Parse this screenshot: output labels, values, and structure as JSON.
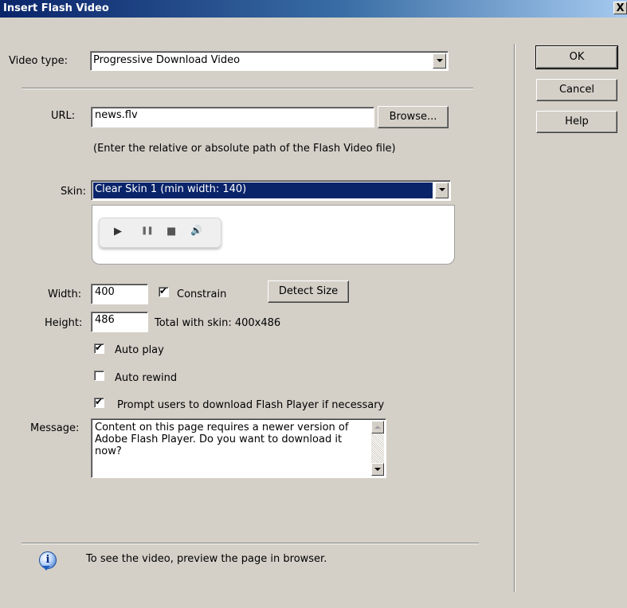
{
  "window": {
    "title": "Insert Flash Video",
    "close_label": "X"
  },
  "video_type": {
    "label": "Video type:",
    "value": "Progressive Download Video"
  },
  "url": {
    "label": "URL:",
    "value": "news.flv",
    "browse_label": "Browse...",
    "hint": "(Enter the relative or absolute path of the Flash Video file)"
  },
  "skin": {
    "label": "Skin:",
    "value": "Clear Skin 1 (min width: 140)",
    "preview_controls": {
      "play": "▶",
      "pause": "❚❚",
      "stop": "■",
      "volume": "🔊"
    }
  },
  "width": {
    "label": "Width:",
    "value": "400"
  },
  "constrain": {
    "label": "Constrain",
    "checked": true
  },
  "detect_size_label": "Detect Size",
  "height": {
    "label": "Height:",
    "value": "486"
  },
  "total_with_skin": "Total with skin: 400x486",
  "options": {
    "auto_play": {
      "label": "Auto play",
      "checked": true
    },
    "auto_rewind": {
      "label": "Auto rewind",
      "checked": false
    },
    "prompt_download": {
      "label": "Prompt users to download Flash Player if necessary",
      "checked": true
    }
  },
  "message": {
    "label": "Message:",
    "value": "Content on this page requires a newer version of Adobe Flash Player. Do you want to download it now?"
  },
  "info_text": "To see the video, preview the page in browser.",
  "buttons": {
    "ok": "OK",
    "cancel": "Cancel",
    "help": "Help"
  }
}
